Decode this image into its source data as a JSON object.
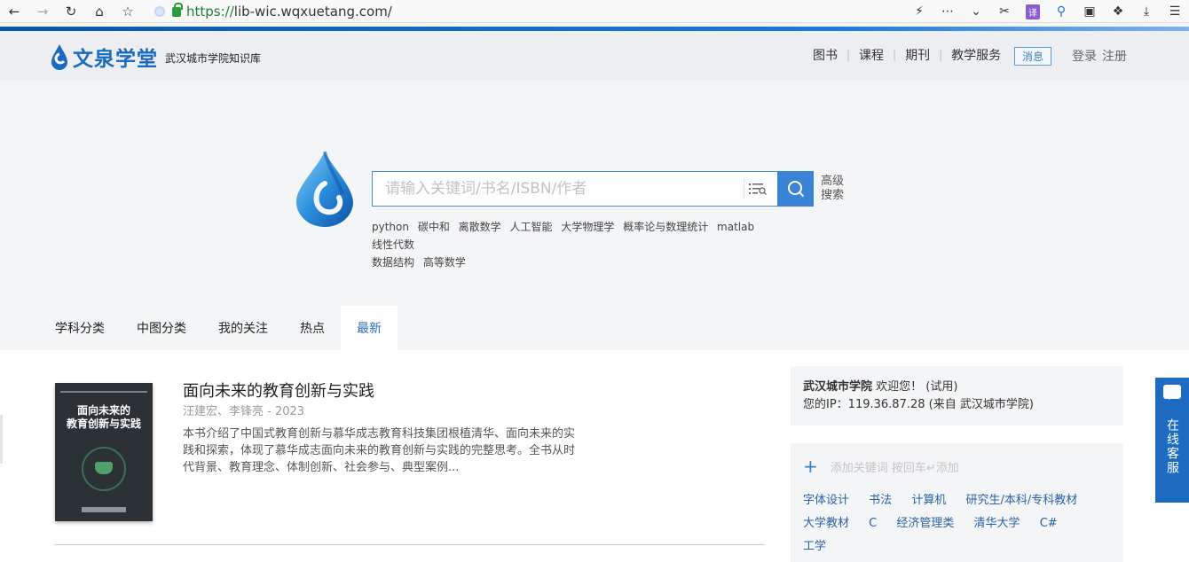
{
  "browser": {
    "url_scheme": "https://",
    "url_rest": "lib-wic.wqxuetang.com/",
    "translate_label": "译"
  },
  "site": {
    "logo_title": "文泉学堂",
    "logo_subtitle": "武汉城市学院知识库",
    "nav": [
      "图书",
      "课程",
      "期刊",
      "教学服务"
    ],
    "message_label": "消息",
    "login_label": "登录",
    "register_label": "注册"
  },
  "search": {
    "placeholder": "请输入关键词/书名/ISBN/作者",
    "advanced_line1": "高级",
    "advanced_line2": "搜索",
    "hot_words": [
      "python",
      "碳中和",
      "离散数学",
      "人工智能",
      "大学物理学",
      "概率论与数理统计",
      "matlab",
      "线性代数",
      "数据结构",
      "高等数学"
    ]
  },
  "tabs": [
    "学科分类",
    "中图分类",
    "我的关注",
    "热点",
    "最新"
  ],
  "book": {
    "cover_line1": "面向未来的",
    "cover_line2": "教育创新与实践",
    "title": "面向未来的教育创新与实践",
    "meta": "汪建宏、李锋亮 - 2023",
    "description": "本书介绍了中国式教育创新与慕华成志教育科技集团根植清华、面向未来的实践和探索，体现了慕华成志面向未来的教育创新与实践的完整思考。全书从时代背景、教育理念、体制创新、社会参与、典型案例..."
  },
  "welcome": {
    "school": "武汉城市学院",
    "greeting": " 欢迎您！ (试用)",
    "ip_line": "您的IP：119.36.87.28 (来自 武汉城市学院)"
  },
  "keywords": {
    "add_placeholder": "添加关键词 按回车↵添加",
    "items": [
      "字体设计",
      "书法",
      "计算机",
      "研究生/本科/专科教材",
      "大学教材",
      "C",
      "经济管理类",
      "清华大学",
      "C#",
      "工学"
    ]
  },
  "service": {
    "label": "在线客服"
  },
  "colors": {
    "brand_blue": "#1a6bbf",
    "search_button": "#3a84d8",
    "service_bg": "#1d6cc1"
  }
}
